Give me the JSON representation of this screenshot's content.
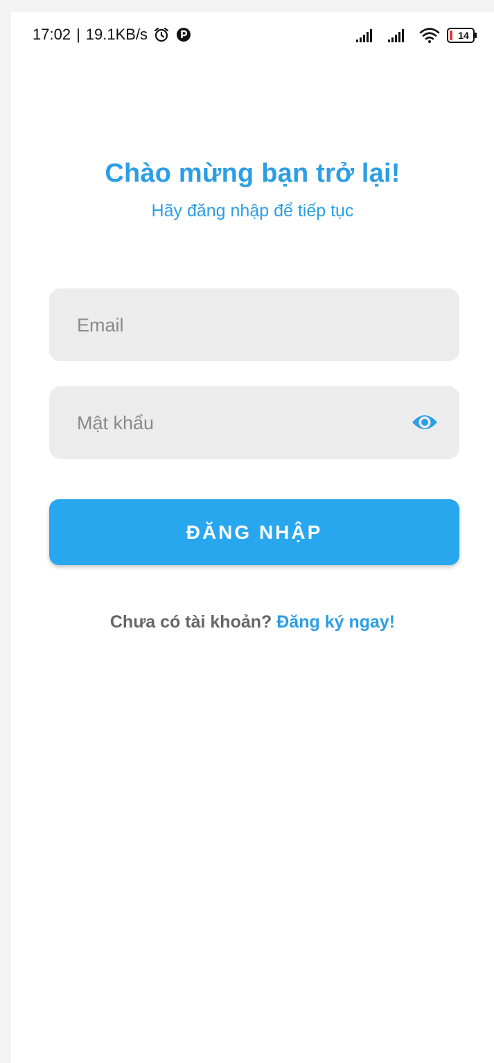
{
  "status_bar": {
    "time": "17:02",
    "separator": "|",
    "network_speed": "19.1KB/s",
    "battery_level": "14",
    "icons": [
      "alarm-icon",
      "app-notification-icon",
      "signal-icon",
      "signal-icon",
      "wifi-icon",
      "battery-icon"
    ]
  },
  "header": {
    "title": "Chào mừng bạn trở lại!",
    "subtitle": "Hãy đăng nhập để tiếp tục"
  },
  "form": {
    "email_placeholder": "Email",
    "email_value": "",
    "password_placeholder": "Mật khẩu",
    "password_value": "",
    "password_toggle_icon": "eye-icon",
    "login_label": "ĐĂNG NHẬP"
  },
  "footer": {
    "prompt": "Chưa có tài khoản?",
    "signup_link": "Đăng ký ngay!"
  },
  "colors": {
    "accent": "#2b9ee5",
    "button": "#28a7ef",
    "field_bg": "#ececec",
    "prompt_text": "#666666"
  }
}
